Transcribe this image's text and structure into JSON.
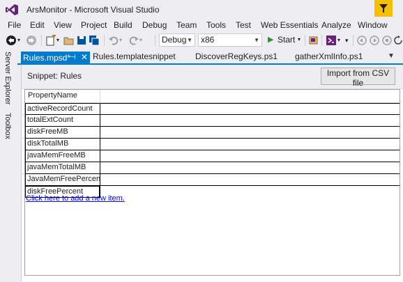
{
  "window": {
    "title": "ArsMonitor - Microsoft Visual Studio"
  },
  "menu": [
    "File",
    "Edit",
    "View",
    "Project",
    "Build",
    "Debug",
    "Team",
    "Tools",
    "Test",
    "Web Essentials",
    "Analyze",
    "Window"
  ],
  "toolbar": {
    "configuration": "Debug",
    "platform": "x86",
    "start_label": "Start"
  },
  "side_tabs": [
    "Server Explorer",
    "Toolbox"
  ],
  "tabs": [
    {
      "label": "Rules.mpsd*",
      "active": true
    },
    {
      "label": "Rules.templatesnippet",
      "active": false
    },
    {
      "label": "DiscoverRegKeys.ps1",
      "active": false
    },
    {
      "label": "gatherXmlInfo.ps1",
      "active": false
    }
  ],
  "editor": {
    "snippet_label": "Snippet: Rules",
    "import_button": "Import from CSV file",
    "column_header": "PropertyName",
    "rows": [
      "activeRecordCount",
      "totalExtCount",
      "diskFreeMB",
      "diskTotalMB",
      "javaMemFreeMB",
      "javaMemTotalMB",
      "JavaMemFreePercent",
      "diskFreePercent"
    ],
    "add_link": "Click here to add a new item."
  },
  "colors": {
    "accent": "#007acc",
    "title_bg": "#eeeef2",
    "filter": "#f5c000"
  }
}
